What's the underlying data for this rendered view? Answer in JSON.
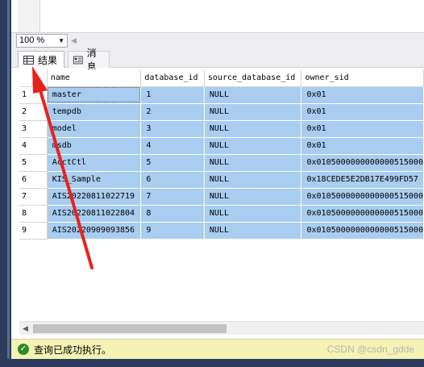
{
  "zoom": {
    "value": "100 %"
  },
  "tabs": [
    {
      "label": "结果",
      "icon": "grid-icon",
      "active": true
    },
    {
      "label": "消息",
      "icon": "message-icon",
      "active": false
    }
  ],
  "grid": {
    "columns": [
      "name",
      "database_id",
      "source_database_id",
      "owner_sid"
    ],
    "rows": [
      {
        "num": "1",
        "name": "master",
        "database_id": "1",
        "source_database_id": "NULL",
        "owner_sid": "0x01"
      },
      {
        "num": "2",
        "name": "tempdb",
        "database_id": "2",
        "source_database_id": "NULL",
        "owner_sid": "0x01"
      },
      {
        "num": "3",
        "name": "model",
        "database_id": "3",
        "source_database_id": "NULL",
        "owner_sid": "0x01"
      },
      {
        "num": "4",
        "name": "msdb",
        "database_id": "4",
        "source_database_id": "NULL",
        "owner_sid": "0x01"
      },
      {
        "num": "5",
        "name": "AcctCtl",
        "database_id": "5",
        "source_database_id": "NULL",
        "owner_sid": "0x0105000000000000515000"
      },
      {
        "num": "6",
        "name": "KIS_Sample",
        "database_id": "6",
        "source_database_id": "NULL",
        "owner_sid": "0x18CEDE5E2DB17E499FD57"
      },
      {
        "num": "7",
        "name": "AIS20220811022719",
        "database_id": "7",
        "source_database_id": "NULL",
        "owner_sid": "0x0105000000000000515000"
      },
      {
        "num": "8",
        "name": "AIS20220811022804",
        "database_id": "8",
        "source_database_id": "NULL",
        "owner_sid": "0x0105000000000000515000"
      },
      {
        "num": "9",
        "name": "AIS20220909093856",
        "database_id": "9",
        "source_database_id": "NULL",
        "owner_sid": "0x0105000000000000515000"
      }
    ]
  },
  "status": {
    "text": "查询已成功执行。",
    "icon": "check-circle-icon",
    "color": "#f5f3b4"
  },
  "watermark": "CSDN @csdn_gdde",
  "colors": {
    "selection": "#a8cdf0",
    "arrow": "#e8231a",
    "frame": "#2b3b5c"
  }
}
